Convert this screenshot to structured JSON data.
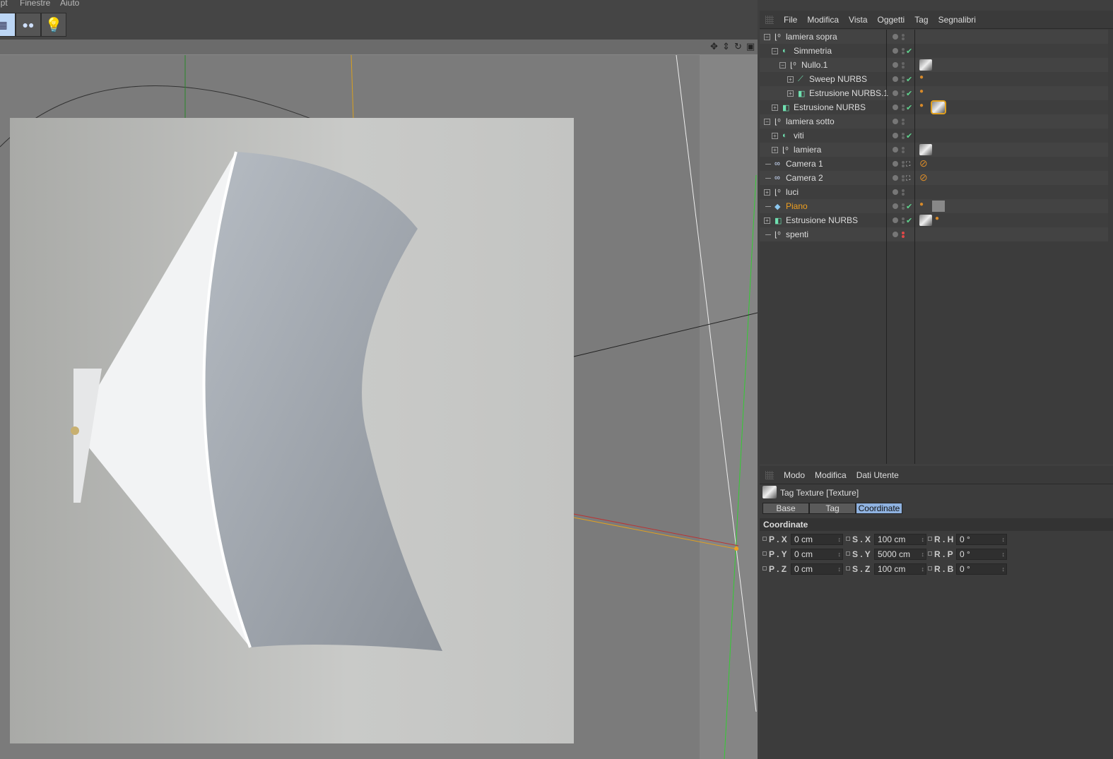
{
  "menubar": {
    "items": [
      "ipt",
      "Finestre",
      "Aiuto"
    ]
  },
  "toolbar": {
    "buttons": [
      {
        "icon": "perspective-view-icon"
      },
      {
        "icon": "camera-icon"
      },
      {
        "icon": "light-bulb-icon"
      }
    ]
  },
  "viewport": {
    "header_icons": [
      "move-icon",
      "zoom-icon",
      "rotate-icon",
      "maximize-icon"
    ]
  },
  "object_manager": {
    "menu": [
      "File",
      "Modifica",
      "Vista",
      "Oggetti",
      "Tag",
      "Segnalibri"
    ],
    "objects": [
      {
        "name": "lamiera sopra",
        "depth": 0,
        "expander": "minus",
        "icon": "null",
        "check": false,
        "tags": []
      },
      {
        "name": "Simmetria",
        "depth": 1,
        "expander": "minus",
        "icon": "symmetry",
        "check": true,
        "tags": []
      },
      {
        "name": "Nullo.1",
        "depth": 2,
        "expander": "minus",
        "icon": "null",
        "check": false,
        "tags": [
          "texture"
        ]
      },
      {
        "name": "Sweep NURBS",
        "depth": 3,
        "expander": "plus",
        "icon": "sweep",
        "check": true,
        "tags": [
          "phong"
        ]
      },
      {
        "name": "Estrusione NURBS.1",
        "depth": 3,
        "expander": "plus",
        "icon": "extrude",
        "check": true,
        "tags": [
          "phong"
        ]
      },
      {
        "name": "Estrusione NURBS",
        "depth": 1,
        "expander": "plus",
        "icon": "extrude",
        "check": true,
        "tags": [
          "phong",
          "texture-selected"
        ]
      },
      {
        "name": "lamiera sotto",
        "depth": 0,
        "expander": "minus",
        "icon": "null",
        "check": false,
        "tags": []
      },
      {
        "name": "viti",
        "depth": 1,
        "expander": "plus",
        "icon": "symmetry",
        "check": true,
        "tags": []
      },
      {
        "name": "lamiera",
        "depth": 1,
        "expander": "plus",
        "icon": "null",
        "check": false,
        "tags": [
          "texture"
        ]
      },
      {
        "name": "Camera 1",
        "depth": 0,
        "expander": "none",
        "icon": "camera",
        "check": false,
        "target": true,
        "tags": [
          "protection"
        ]
      },
      {
        "name": "Camera 2",
        "depth": 0,
        "expander": "none",
        "icon": "camera",
        "check": false,
        "target": true,
        "tags": [
          "protection"
        ]
      },
      {
        "name": "luci",
        "depth": 0,
        "expander": "plus",
        "icon": "null",
        "check": false,
        "tags": []
      },
      {
        "name": "Piano",
        "depth": 0,
        "expander": "none",
        "icon": "plane",
        "check": true,
        "selected": true,
        "tags": [
          "phong",
          "material"
        ]
      },
      {
        "name": "Estrusione NURBS",
        "depth": 0,
        "expander": "plus",
        "icon": "extrude",
        "check": true,
        "tags": [
          "texture",
          "phong"
        ]
      },
      {
        "name": "spenti",
        "depth": 0,
        "expander": "none",
        "icon": "null",
        "check": false,
        "disabled": true,
        "tags": []
      }
    ]
  },
  "attributes": {
    "menu": [
      "Modo",
      "Modifica",
      "Dati Utente"
    ],
    "title": "Tag Texture [Texture]",
    "tabs": [
      "Base",
      "Tag",
      "Coordinate"
    ],
    "active_tab": "Coordinate",
    "section": "Coordinate",
    "fields": [
      {
        "label": "P . X",
        "value": "0 cm"
      },
      {
        "label": "S . X",
        "value": "100 cm"
      },
      {
        "label": "R . H",
        "value": "0 °"
      },
      {
        "label": "P . Y",
        "value": "0 cm"
      },
      {
        "label": "S . Y",
        "value": "5000 cm"
      },
      {
        "label": "R . P",
        "value": "0 °"
      },
      {
        "label": "P . Z",
        "value": "0 cm"
      },
      {
        "label": "S . Z",
        "value": "100 cm"
      },
      {
        "label": "R . B",
        "value": "0 °"
      }
    ]
  },
  "colors": {
    "selected_object": "#f0a020",
    "active_tab": "#8fb2e0",
    "check": "#5fd38d"
  }
}
